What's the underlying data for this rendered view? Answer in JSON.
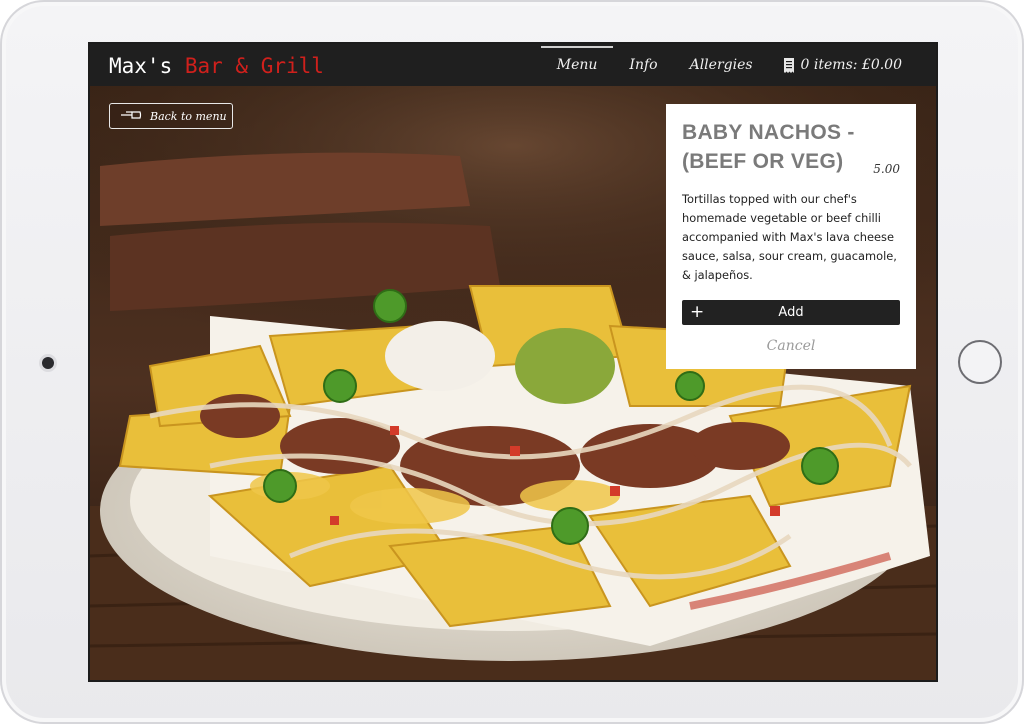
{
  "brand": {
    "part1": "Max's ",
    "part2": "Bar & Grill"
  },
  "nav": {
    "items": [
      {
        "label": "Menu",
        "active": true
      },
      {
        "label": "Info",
        "active": false
      },
      {
        "label": "Allergies",
        "active": false
      }
    ],
    "basket": {
      "icon": "receipt-icon",
      "label": "0 items: £0.00"
    }
  },
  "back_button": {
    "icon": "pointing-hand-icon",
    "label": "Back to menu"
  },
  "item": {
    "title": "BABY NACHOS - (BEEF OR VEG)",
    "price": "5.00",
    "description": "Tortillas topped with our chef's homemade vegetable or beef chilli accompanied with Max's lava cheese sauce, salsa, sour cream, guacamole, & jalapeños.",
    "add_icon": "plus-icon",
    "add_label": "Add",
    "cancel_label": "Cancel"
  },
  "colors": {
    "brand_red": "#d0201c",
    "nav_bg": "#1f1f1f",
    "button_bg": "#222222"
  },
  "image": {
    "alt": "nachos-photo"
  }
}
